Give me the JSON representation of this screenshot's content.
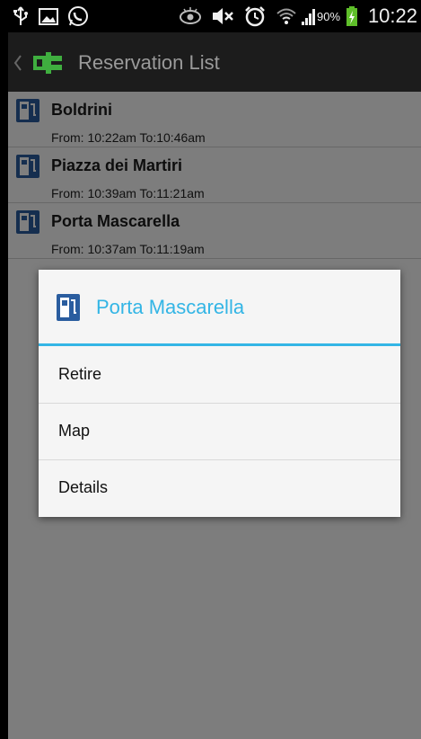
{
  "status_bar": {
    "battery_percent": "90%",
    "time": "10:22",
    "icons": [
      "usb-icon",
      "image-icon",
      "whatsapp-icon",
      "eye-icon",
      "mute-icon",
      "alarm-icon",
      "wifi-icon",
      "signal-icon",
      "battery-charging-icon"
    ]
  },
  "action_bar": {
    "title": "Reservation List",
    "icons": [
      "back-chevron-icon",
      "app-logo-icon"
    ]
  },
  "reservations": [
    {
      "name": "Boldrini",
      "time": "From: 10:22am To:10:46am"
    },
    {
      "name": "Piazza dei Martiri",
      "time": "From: 10:39am To:11:21am"
    },
    {
      "name": "Porta Mascarella",
      "time": "From: 10:37am To:11:19am"
    }
  ],
  "dialog": {
    "title": "Porta Mascarella",
    "items": [
      {
        "label": "Retire"
      },
      {
        "label": "Map"
      },
      {
        "label": "Details"
      }
    ]
  },
  "colors": {
    "accent": "#33b5e5",
    "action_bar": "#1c1c1c",
    "station_icon": "#2a5d9f",
    "logo_green": "#3fae3f"
  }
}
